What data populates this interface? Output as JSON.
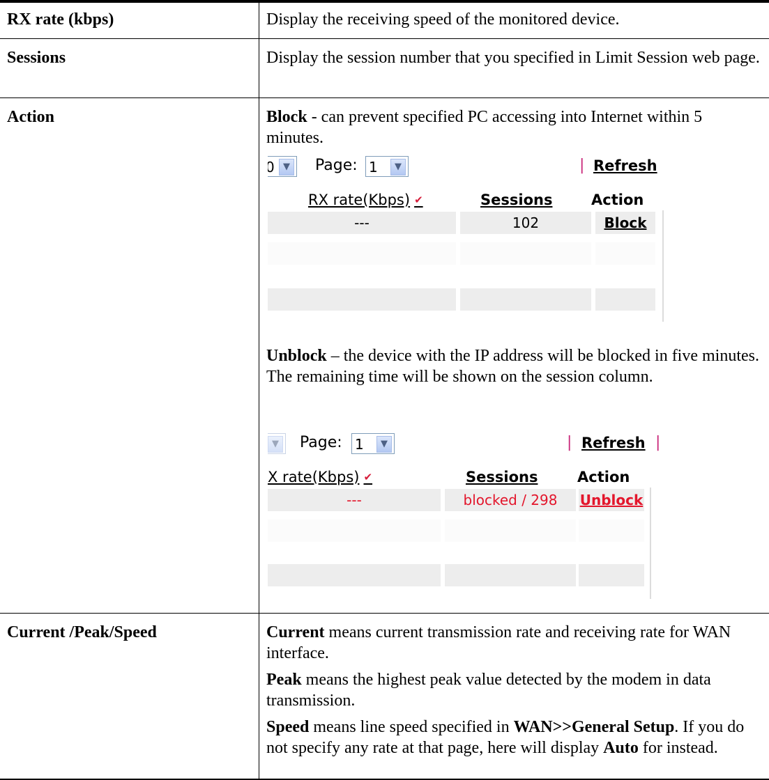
{
  "rows": [
    {
      "term": "RX rate (kbps)",
      "desc": "Display the receiving speed of the monitored device."
    },
    {
      "term": "Sessions",
      "desc": "Display the session number that you specified in Limit Session web page."
    },
    {
      "term": "Action",
      "block_bold": "Block",
      "block_text": " - can prevent specified PC accessing into Internet within 5 minutes.",
      "unblock_bold": "Unblock",
      "unblock_text": " – the device with the IP address will be blocked in five minutes. The remaining time will be shown on the session column."
    },
    {
      "term": "Current /Peak/Speed",
      "current_bold": "Current",
      "current_text": " means current transmission rate and receiving rate for WAN interface.",
      "peak_bold": "Peak",
      "peak_text": " means the highest peak value detected by the modem in data transmission.",
      "speed_bold": "Speed",
      "speed_text1": " means line speed specified in ",
      "speed_bold2": "WAN>>General Setup",
      "speed_text2": ". If you do not specify any rate at that page, here will display ",
      "speed_bold3": "Auto",
      "speed_text3": " for instead."
    }
  ],
  "shot_block": {
    "left_dropdown_value": "0",
    "page_label": "Page:",
    "page_value": "1",
    "pipe": "|",
    "refresh": "Refresh",
    "col_rx": "RX rate(Kbps)",
    "col_sessions": "Sessions",
    "col_action": "Action",
    "rx_value": "---",
    "sessions_value": "102",
    "action_value": "Block"
  },
  "shot_unblock": {
    "page_label": "Page:",
    "page_value": "1",
    "pipe": "|",
    "refresh": "Refresh",
    "col_rx": "X rate(Kbps)",
    "col_sessions": "Sessions",
    "col_action": "Action",
    "rx_value": "---",
    "sessions_value": "blocked / 298",
    "action_value": "Unblock"
  },
  "colors": {
    "red_text": "#e3162c",
    "pipe": "#c92a7b",
    "sort_arrow": "#d61d3a",
    "row_fill": "#ededed"
  }
}
